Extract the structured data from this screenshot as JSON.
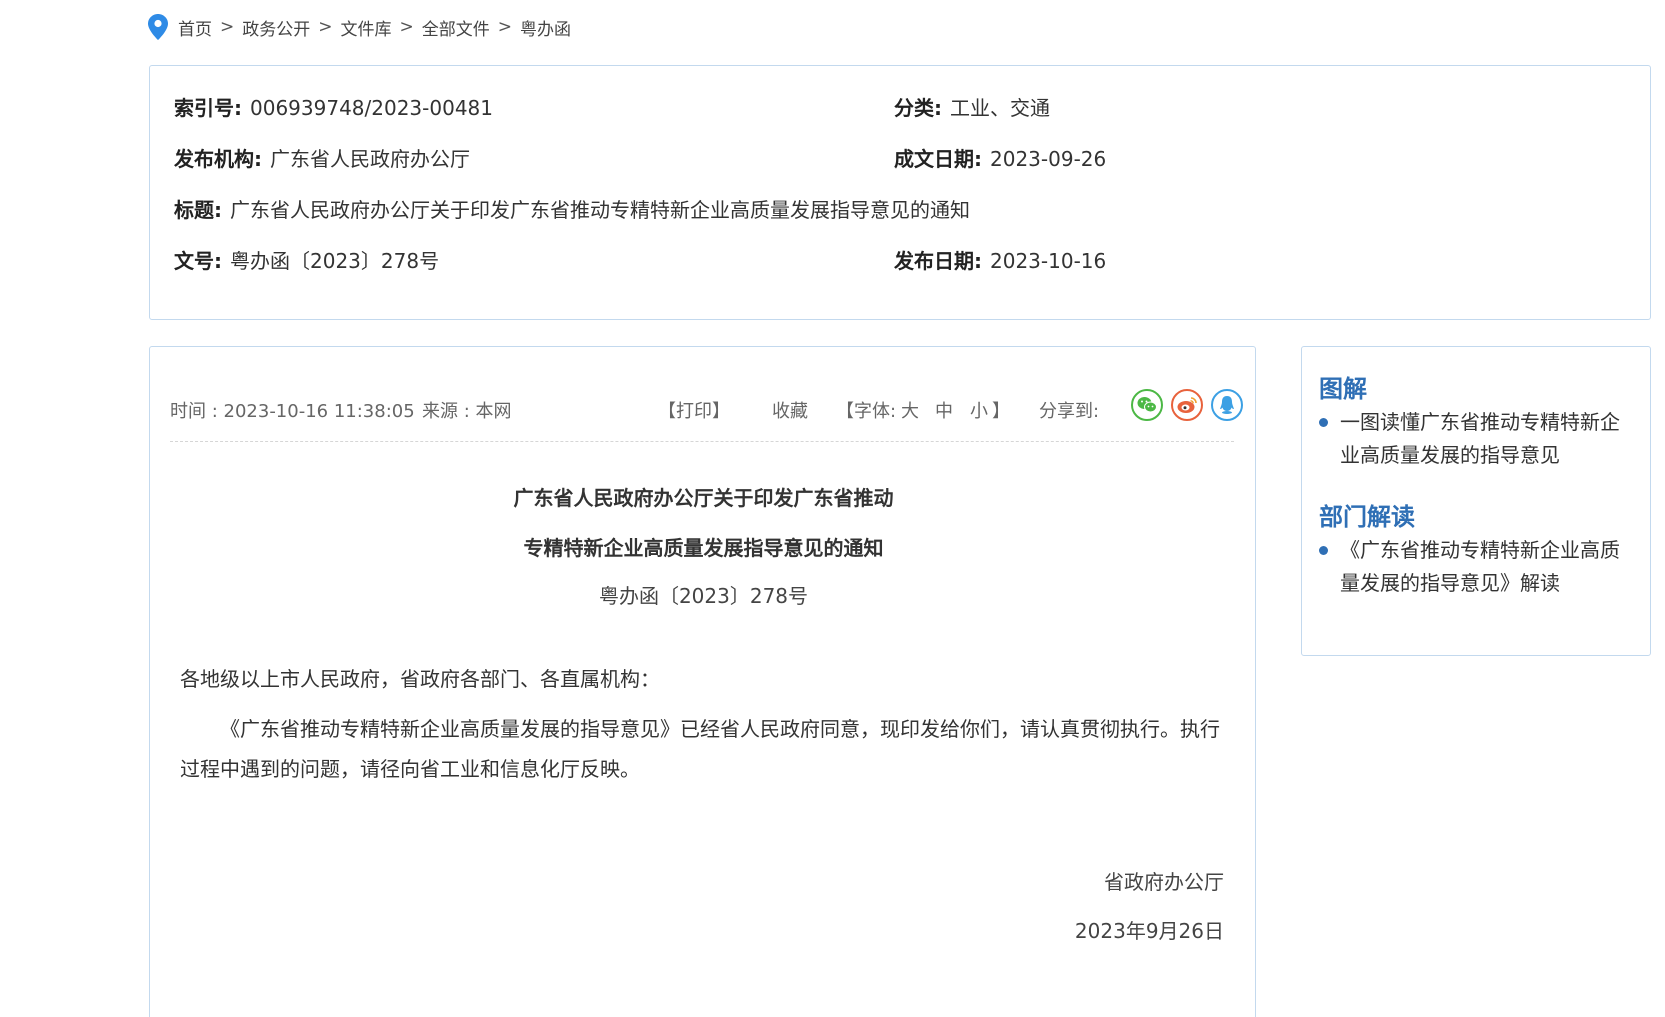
{
  "breadcrumb": [
    "首页",
    "政务公开",
    "文件库",
    "全部文件",
    "粤办函"
  ],
  "breadcrumb_separator": ">",
  "info": {
    "index_label": "索引号:",
    "index_value": "006939748/2023-00481",
    "category_label": "分类:",
    "category_value": "工业、交通",
    "publisher_label": "发布机构:",
    "publisher_value": "广东省人民政府办公厅",
    "written_date_label": "成文日期:",
    "written_date_value": "2023-09-26",
    "title_label": "标题:",
    "title_value": "广东省人民政府办公厅关于印发广东省推动专精特新企业高质量发展指导意见的通知",
    "doc_no_label": "文号:",
    "doc_no_value": "粤办函〔2023〕278号",
    "publish_date_label": "发布日期:",
    "publish_date_value": "2023-10-16"
  },
  "meta": {
    "time": "时间 : 2023-10-16 11:38:05",
    "source": "来源 : 本网",
    "print": "【打印】",
    "favorite": "收藏",
    "font_open": "【字体:",
    "font_large": "大",
    "font_medium": "中",
    "font_small": "小",
    "font_close": "】",
    "share": "分享到:"
  },
  "article": {
    "title_line1": "广东省人民政府办公厅关于印发广东省推动",
    "title_line2": "专精特新企业高质量发展指导意见的通知",
    "doc_number": "粤办函〔2023〕278号",
    "salutation": "各地级以上市人民政府，省政府各部门、各直属机构：",
    "body": "《广东省推动专精特新企业高质量发展的指导意见》已经省人民政府同意，现印发给你们，请认真贯彻执行。执行过程中遇到的问题，请径向省工业和信息化厅反映。",
    "signature": "省政府办公厅",
    "date": "2023年9月26日"
  },
  "sidebar": {
    "section1_title": "图解",
    "section1_items": [
      "一图读懂广东省推动专精特新企业高质量发展的指导意见"
    ],
    "section2_title": "部门解读",
    "section2_items": [
      "《广东省推动专精特新企业高质量发展的指导意见》解读"
    ]
  },
  "colors": {
    "accent": "#2f6fb5",
    "border": "#c3d9ee",
    "wechat": "#4cb845",
    "weibo": "#e8623c",
    "qq": "#3ca0e4"
  },
  "icons": [
    "location-pin-icon",
    "wechat-icon",
    "weibo-icon",
    "qq-icon"
  ]
}
